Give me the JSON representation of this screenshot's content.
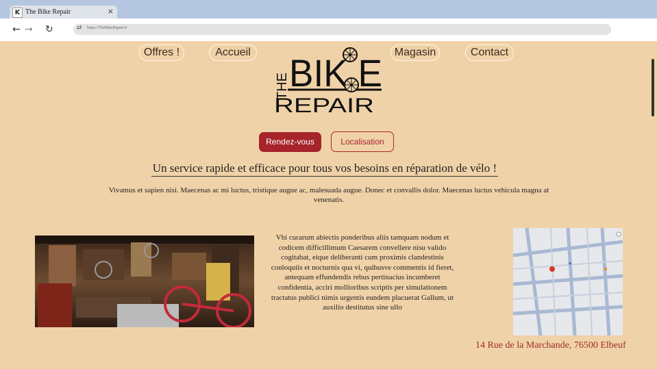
{
  "browser": {
    "tab_title": "The Bike Repair",
    "favicon_letter": "K",
    "tab_close": "×",
    "url": "https://TheBikeRepair.fr"
  },
  "nav": {
    "offres": "Offres !",
    "accueil": "Accueil",
    "magasin": "Magasin",
    "contact": "Contact"
  },
  "logo": {
    "the": "THE",
    "bike": "BIK E",
    "repair": "REPAIR"
  },
  "actions": {
    "rendezvous": "Rendez-vous",
    "localisation": "Localisation"
  },
  "headline": "Un service rapide et efficace pour tous vos besoins en réparation de vélo !",
  "intro": "Vivamus et sapien nisi. Maecenas ac mi luctus, tristique augue ac, malesuada augue. Donec et convallis dolor. Maecenas luctus vehicula magna at venenatis.",
  "body_text": "Vbi curarum abiectis ponderibus aliis tamquam nodum et codicem difficillimum Caesarem convellere nisu valido cogitabat, eique deliberanti cum proximis clandestinis conloquiis et nocturnis qua vi, quibusve commentis id fieret, antequam effundendis rebus pertinacius incumberet confidentia, acciri mollioribus scriptis per simulationem tractatus publici nimis urgentis eundem placuerat Gallum, ut auxilio destitutus sine ullo",
  "address": "14 Rue de la Marchande, 76500 Elbeuf",
  "colors": {
    "page_bg": "#f0d2a8",
    "accent": "#a6242a",
    "address": "#9e2a2a"
  }
}
